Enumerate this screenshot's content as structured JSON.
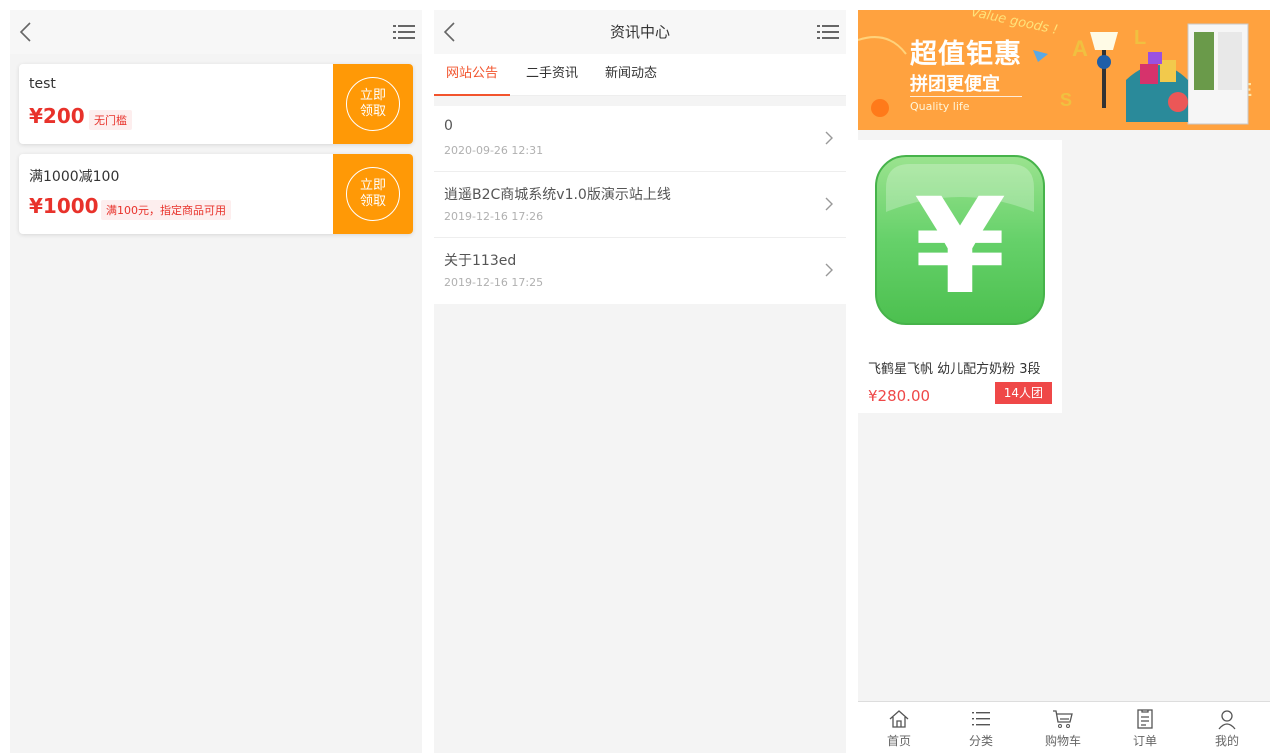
{
  "coupons": {
    "items": [
      {
        "title": "test",
        "price": "¥200",
        "tag": "无门槛",
        "button_line1": "立即",
        "button_line2": "领取"
      },
      {
        "title": "满1000减100",
        "price": "¥1000",
        "tag": "满100元，指定商品可用",
        "button_line1": "立即",
        "button_line2": "领取"
      }
    ]
  },
  "news": {
    "title": "资讯中心",
    "tabs": [
      {
        "label": "网站公告",
        "active": true
      },
      {
        "label": "二手资讯",
        "active": false
      },
      {
        "label": "新闻动态",
        "active": false
      }
    ],
    "items": [
      {
        "title": "0",
        "date": "2020-09-26 12:31"
      },
      {
        "title": "逍遥B2C商城系统v1.0版演示站上线",
        "date": "2019-12-16 17:26"
      },
      {
        "title": "关于113ed",
        "date": "2019-12-16 17:25"
      }
    ]
  },
  "shop": {
    "banner": {
      "headline": "超值钜惠",
      "subline": "拼团更便宜",
      "english": "Quality life",
      "script": "Value goods !"
    },
    "product": {
      "name": "飞鹤星飞帆 幼儿配方奶粉 3段",
      "price": "¥280.00",
      "badge": "14人团",
      "image_symbol": "¥"
    },
    "tabbar": [
      {
        "label": "首页",
        "icon": "home-icon"
      },
      {
        "label": "分类",
        "icon": "list-icon"
      },
      {
        "label": "购物车",
        "icon": "cart-icon"
      },
      {
        "label": "订单",
        "icon": "order-icon"
      },
      {
        "label": "我的",
        "icon": "user-icon"
      }
    ]
  },
  "colors": {
    "accent": "#ff9906",
    "price_red": "#e8322b",
    "tab_active": "#f2542d",
    "badge_red": "#ef4848",
    "icon_green": "#66d16a"
  }
}
